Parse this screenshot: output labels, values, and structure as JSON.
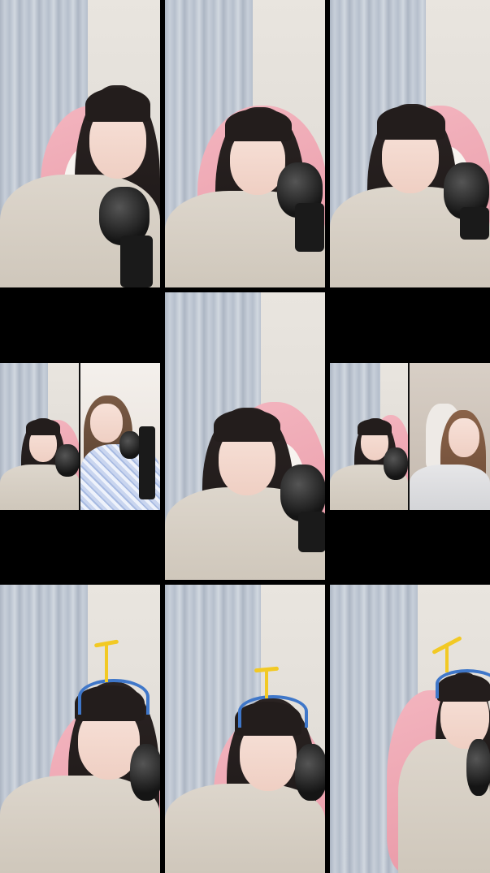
{
  "layout": {
    "description_mode": "image-grid",
    "rows": 3,
    "columns": 3
  },
  "tiles": [
    {
      "id": "tile-1",
      "kind": "single-stream",
      "accessory": "none"
    },
    {
      "id": "tile-2",
      "kind": "single-stream",
      "accessory": "none"
    },
    {
      "id": "tile-3",
      "kind": "single-stream",
      "accessory": "none"
    },
    {
      "id": "tile-4",
      "kind": "split-stream",
      "accessory": "none"
    },
    {
      "id": "tile-5",
      "kind": "single-stream",
      "accessory": "none"
    },
    {
      "id": "tile-6",
      "kind": "split-stream",
      "accessory": "none"
    },
    {
      "id": "tile-7",
      "kind": "single-stream",
      "accessory": "propeller-headband"
    },
    {
      "id": "tile-8",
      "kind": "single-stream",
      "accessory": "propeller-headband"
    },
    {
      "id": "tile-9",
      "kind": "single-stream",
      "accessory": "propeller-headband"
    }
  ],
  "colors": {
    "background": "#000000",
    "chair_pink": "#e999a7",
    "curtain": "#b3bdcb",
    "propeller_yellow": "#f2c924",
    "headband_blue": "#3f77c9"
  }
}
